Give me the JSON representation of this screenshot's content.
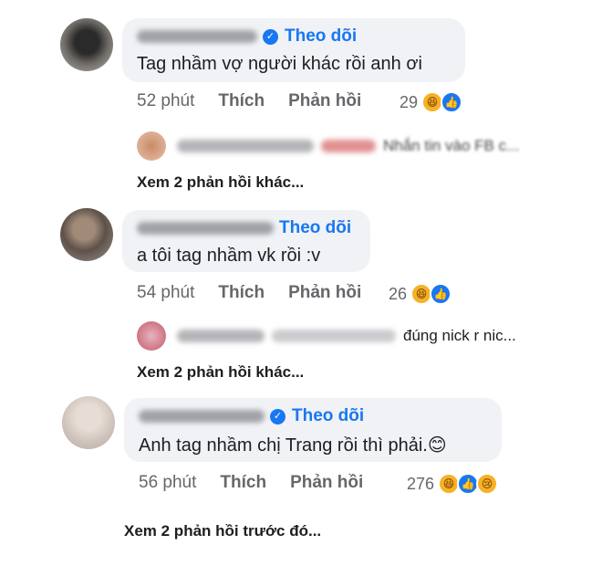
{
  "comments": [
    {
      "follow_label": "Theo dõi",
      "text": "Tag nhầm vợ người khác rồi anh ơi",
      "time": "52 phút",
      "like_label": "Thích",
      "reply_label": "Phản hồi",
      "reaction_count": "29",
      "reactions": [
        "haha-icon",
        "like-icon"
      ],
      "reply_preview_text": "Nhắn tin vào FB c...",
      "more_replies": "Xem 2 phản hồi khác..."
    },
    {
      "follow_label": "Theo dõi",
      "text": "a tôi tag nhầm vk rồi :v",
      "time": "54 phút",
      "like_label": "Thích",
      "reply_label": "Phản hồi",
      "reaction_count": "26",
      "reactions": [
        "haha-icon",
        "like-icon"
      ],
      "reply_preview_text": "đúng nick r nic...",
      "more_replies": "Xem 2 phản hồi khác..."
    },
    {
      "follow_label": "Theo dõi",
      "text": "Anh tag nhầm chị Trang rồi thì phải.",
      "emoji": "😊",
      "time": "56 phút",
      "like_label": "Thích",
      "reply_label": "Phản hồi",
      "reaction_count": "276",
      "reactions": [
        "haha-icon",
        "like-icon",
        "sad-icon"
      ],
      "more_replies": "Xem 2 phản hồi trước đó..."
    }
  ],
  "colors": {
    "link": "#1877f2",
    "meta": "#65676b",
    "bubble": "#f0f2f5"
  }
}
